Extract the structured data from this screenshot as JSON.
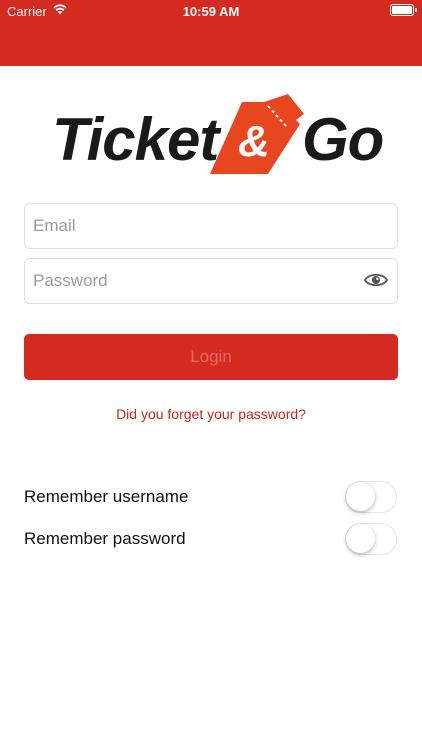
{
  "status_bar": {
    "carrier": "Carrier",
    "time": "10:59 AM",
    "wifi_icon": "wifi-icon",
    "battery_icon": "battery-icon"
  },
  "logo": {
    "word_left": "Ticket",
    "ampersand": "&",
    "word_right": "Go",
    "accent_color": "#e8461f"
  },
  "form": {
    "email_placeholder": "Email",
    "email_value": "",
    "password_placeholder": "Password",
    "password_value": "",
    "show_password_icon": "eye-icon",
    "login_label": "Login",
    "forgot_link": "Did you forget your password?"
  },
  "settings": [
    {
      "label": "Remember username",
      "enabled": false
    },
    {
      "label": "Remember password",
      "enabled": false
    }
  ],
  "colors": {
    "brand_red": "#d42a1f",
    "link_red": "#c8271d",
    "login_text_disabled": "#e56b62"
  }
}
